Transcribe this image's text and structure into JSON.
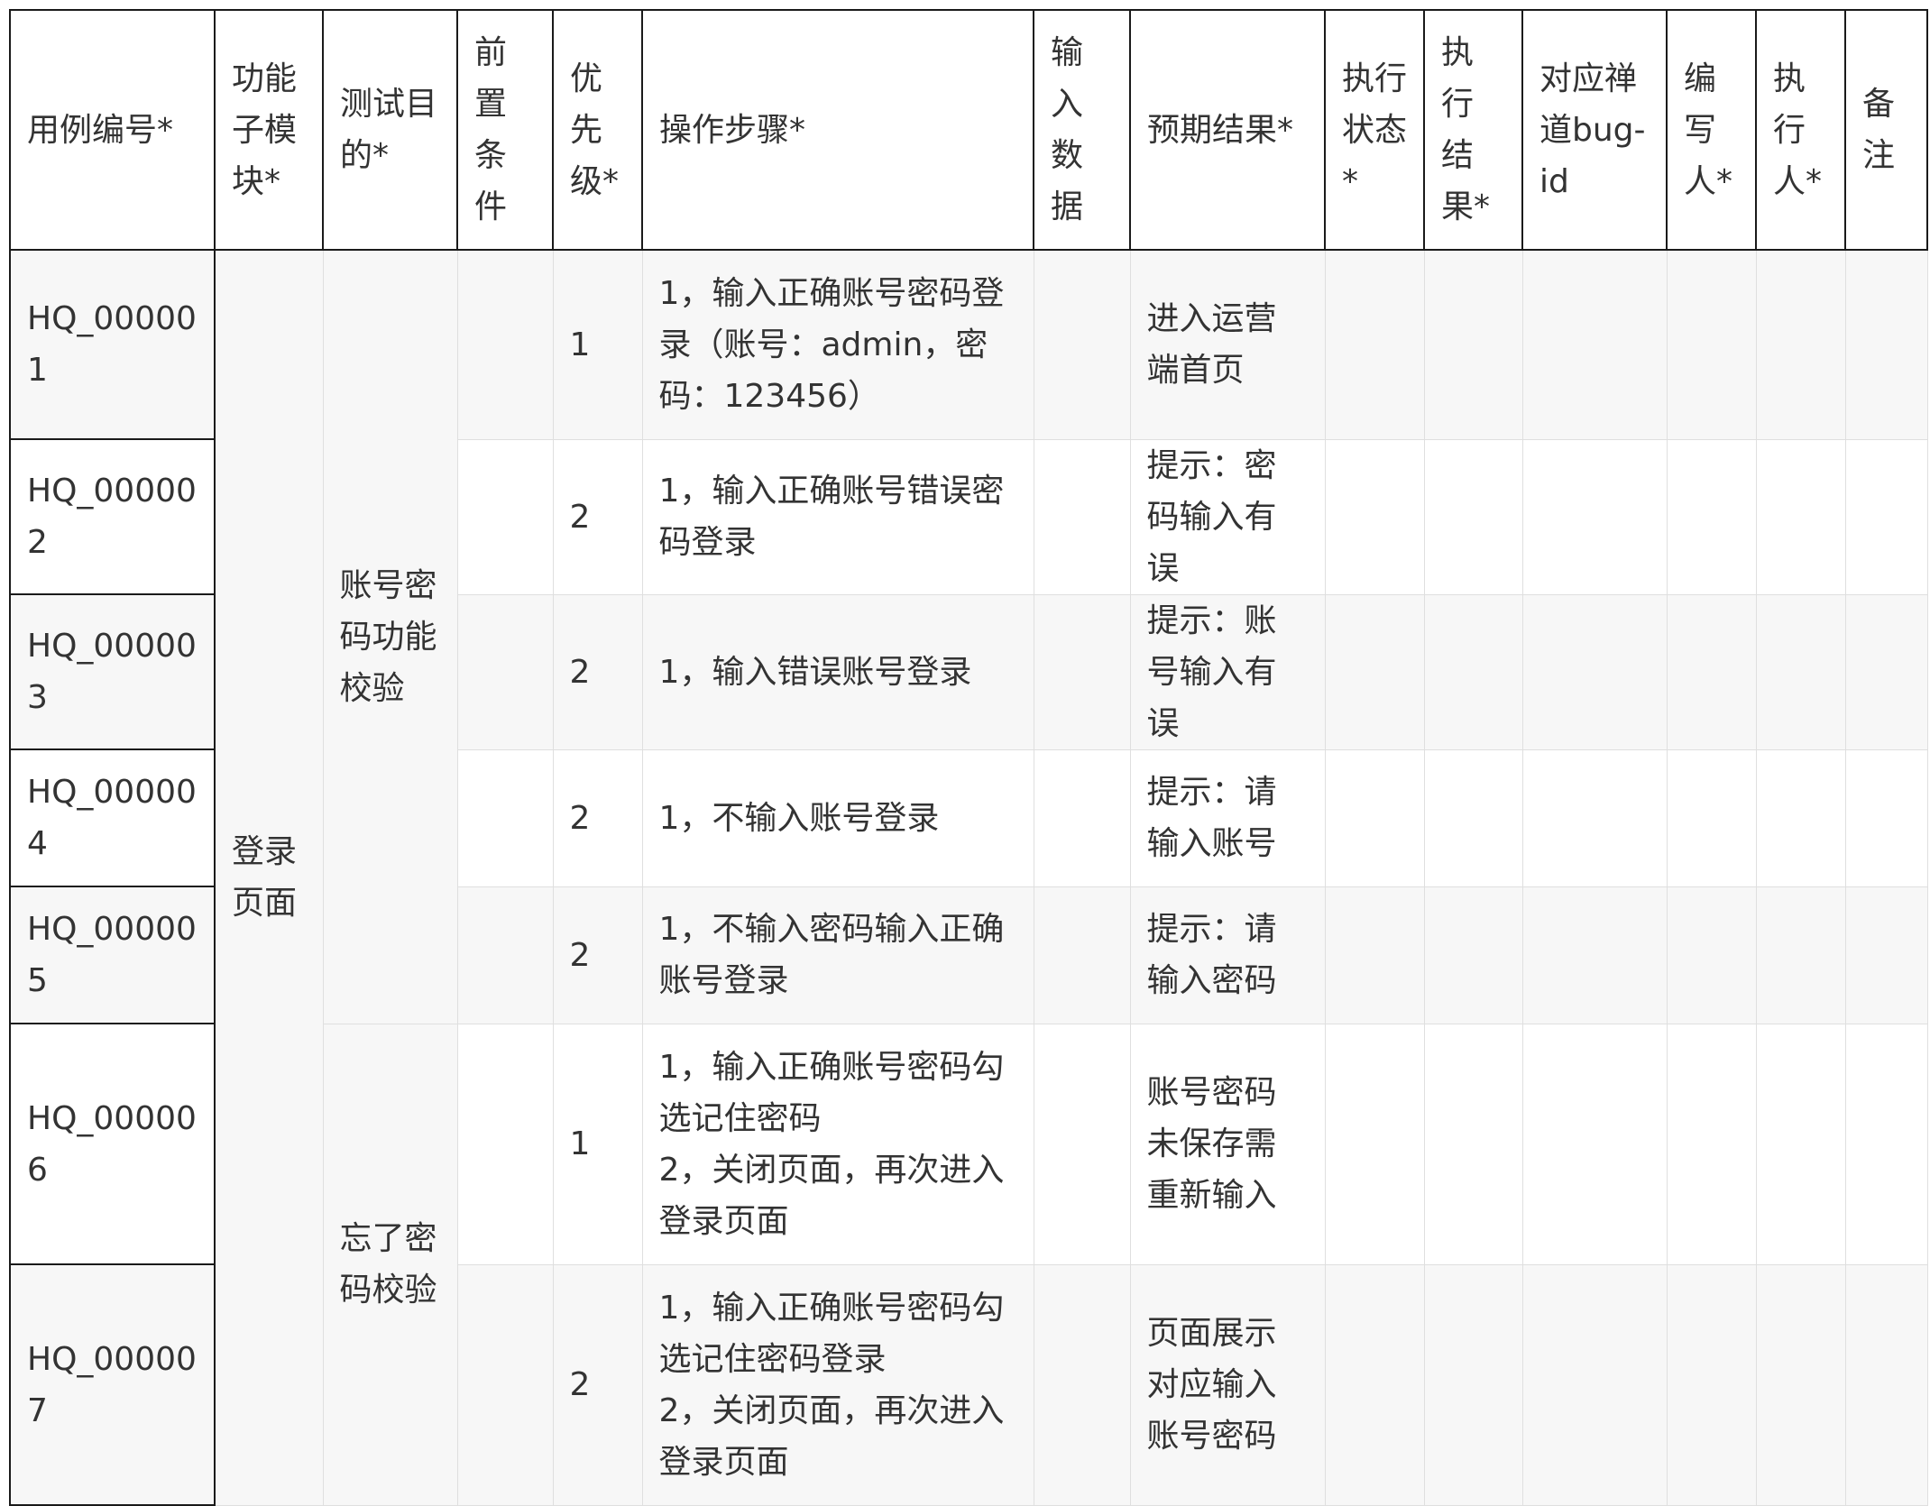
{
  "headers": [
    "用例编号*",
    "功能子模块*",
    "测试目的*",
    "前置条件",
    "优先级*",
    "操作步骤*",
    "输入数据",
    "预期结果*",
    "执行状态*",
    "执行结果*",
    "对应禅道bug-id",
    "编写人*",
    "执行人*",
    "备注"
  ],
  "module": "登录页面",
  "groups": [
    {
      "purpose": "账号密码功能校验"
    },
    {
      "purpose": "忘了密码校验"
    }
  ],
  "rows": [
    {
      "id": "HQ_000001",
      "priority": "1",
      "steps": "1，输入正确账号密码登录（账号：admin，密码：123456）",
      "expected": "进入运营端首页"
    },
    {
      "id": "HQ_000002",
      "priority": "2",
      "steps": "1，输入正确账号错误密码登录",
      "expected": "提示：密码输入有误"
    },
    {
      "id": "HQ_000003",
      "priority": "2",
      "steps": "1，输入错误账号登录",
      "expected": "提示：账号输入有误"
    },
    {
      "id": "HQ_000004",
      "priority": "2",
      "steps": "1，不输入账号登录",
      "expected": "提示：请输入账号"
    },
    {
      "id": "HQ_000005",
      "priority": "2",
      "steps": "1，不输入密码输入正确账号登录",
      "expected": "提示：请输入密码"
    },
    {
      "id": "HQ_000006",
      "priority": "1",
      "steps": "1，输入正确账号密码勾选记住密码\n2，关闭页面，再次进入登录页面",
      "expected": "账号密码未保存需重新输入"
    },
    {
      "id": "HQ_000007",
      "priority": "2",
      "steps": "1，输入正确账号密码勾选记住密码登录\n2，关闭页面，再次进入登录页面",
      "expected": "页面展示对应输入账号密码"
    }
  ]
}
